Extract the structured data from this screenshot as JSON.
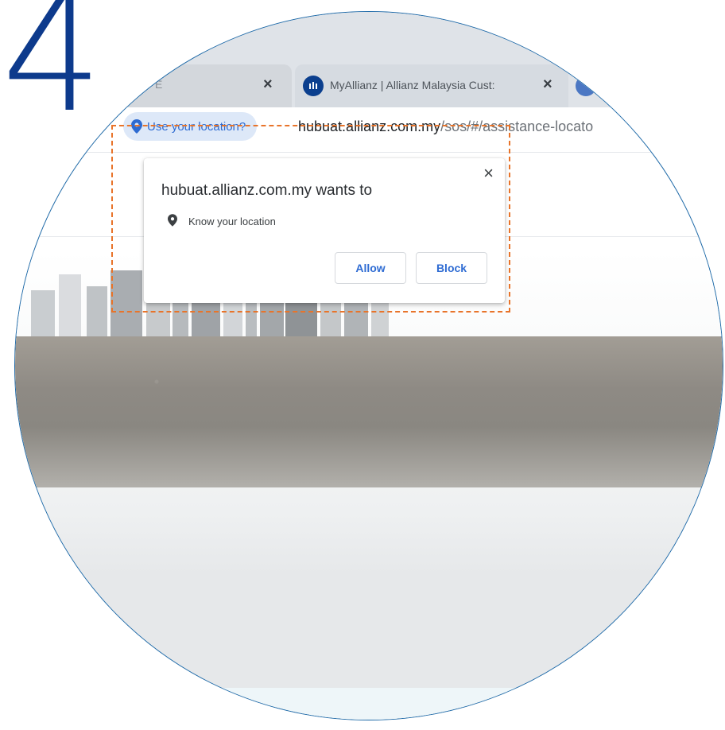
{
  "step": {
    "number": "4"
  },
  "browser": {
    "tabs": [
      {
        "title": "E",
        "close_icon": "×"
      },
      {
        "title": "MyAllianz | Allianz Malaysia Cust:",
        "favicon": "allianz-logo-icon",
        "close_icon": "×"
      }
    ],
    "omnibox": {
      "location_chip": "Use your location?",
      "url_domain": "hubuat.allianz.com.my",
      "url_path": "/sos/#/assistance-locato"
    }
  },
  "popup": {
    "title": "hubuat.allianz.com.my wants to",
    "permission": "Know your location",
    "allow_label": "Allow",
    "block_label": "Block",
    "close_icon": "×"
  },
  "colors": {
    "step_number": "#0d3a8c",
    "circle_border": "#1f6aa8",
    "highlight": "#e8742a",
    "button_text": "#2f6cd3"
  }
}
